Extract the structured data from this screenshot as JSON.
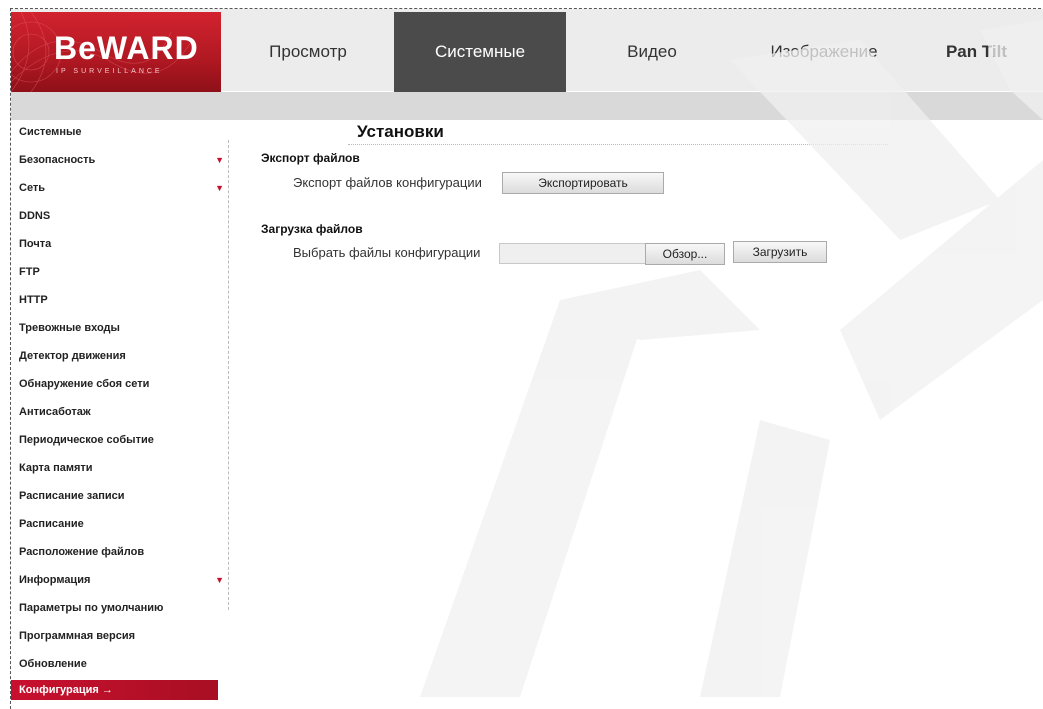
{
  "brand": {
    "name": "BeWARD",
    "tagline": "IP SURVEILLANCE"
  },
  "tabs": [
    {
      "label": "Просмотр",
      "active": false
    },
    {
      "label": "Системные",
      "active": true
    },
    {
      "label": "Видео",
      "active": false
    },
    {
      "label": "Изображение",
      "active": false
    },
    {
      "label": "Pan Tilt",
      "active": false
    }
  ],
  "sidebar": {
    "items": [
      {
        "label": "Системные",
        "arrow": ""
      },
      {
        "label": "Безопасность",
        "arrow": "▼"
      },
      {
        "label": "Сеть",
        "arrow": "▼"
      },
      {
        "label": "DDNS",
        "arrow": ""
      },
      {
        "label": "Почта",
        "arrow": ""
      },
      {
        "label": "FTP",
        "arrow": ""
      },
      {
        "label": "HTTP",
        "arrow": ""
      },
      {
        "label": "Тревожные входы",
        "arrow": ""
      },
      {
        "label": "Детектор движения",
        "arrow": ""
      },
      {
        "label": "Обнаружение сбоя сети",
        "arrow": ""
      },
      {
        "label": "Антисаботаж",
        "arrow": ""
      },
      {
        "label": "Периодическое событие",
        "arrow": ""
      },
      {
        "label": "Карта памяти",
        "arrow": ""
      },
      {
        "label": "Расписание записи",
        "arrow": ""
      },
      {
        "label": "Расписание",
        "arrow": ""
      },
      {
        "label": "Расположение файлов",
        "arrow": ""
      },
      {
        "label": "Информация",
        "arrow": "▼"
      },
      {
        "label": "Параметры по умолчанию",
        "arrow": ""
      },
      {
        "label": "Программная версия",
        "arrow": ""
      },
      {
        "label": "Обновление",
        "arrow": ""
      }
    ],
    "active_item": "Конфигурация →"
  },
  "main": {
    "title": "Установки",
    "export": {
      "section": "Экспорт файлов",
      "label": "Экспорт файлов конфигурации",
      "button": "Экспортировать"
    },
    "upload": {
      "section": "Загрузка файлов",
      "label": "Выбрать файлы конфигурации",
      "browse": "Обзор...",
      "button": "Загрузить"
    }
  },
  "colors": {
    "accent": "#c8102e",
    "active_tab": "#4b4b4b",
    "header": "#ececec"
  }
}
